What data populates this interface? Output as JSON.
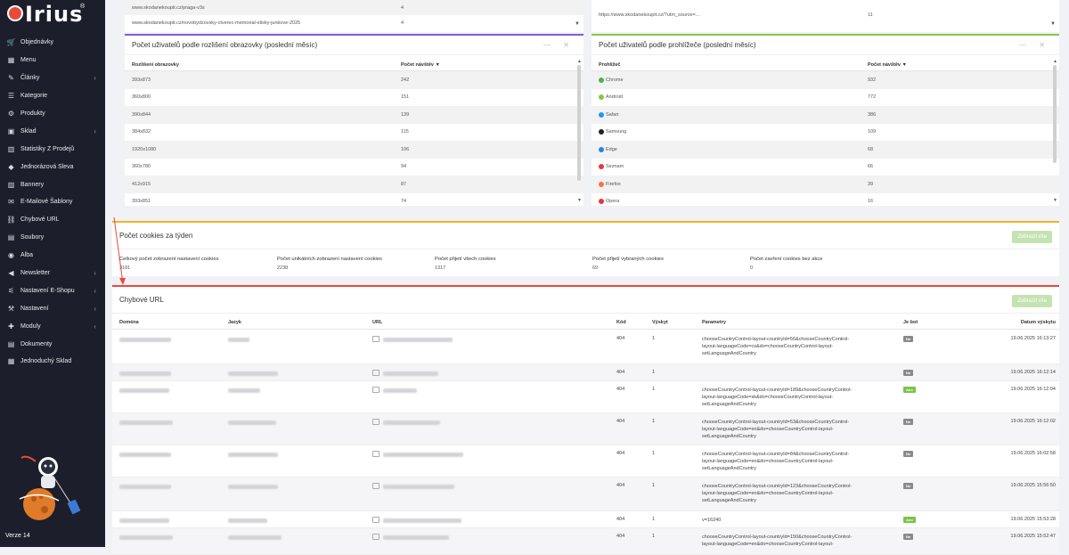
{
  "app": {
    "brand": "Irius",
    "version": "Verze 14",
    "colors": {
      "sidebar": "#1c1f2b",
      "accent_red": "#e84b3c",
      "green_btn": "#c5e3b2"
    }
  },
  "sidebar": {
    "items": [
      {
        "label": "Objednávky",
        "icon": "cart-icon",
        "chevron": false
      },
      {
        "label": "Menu",
        "icon": "menu-icon",
        "chevron": false
      },
      {
        "label": "Články",
        "icon": "pencil-icon",
        "chevron": true
      },
      {
        "label": "Kategorie",
        "icon": "list-icon",
        "chevron": false
      },
      {
        "label": "Produkty",
        "icon": "settings-icon",
        "chevron": false
      },
      {
        "label": "Sklad",
        "icon": "box-icon",
        "chevron": true
      },
      {
        "label": "Statistiky Z Prodejů",
        "icon": "chart-icon",
        "chevron": false
      },
      {
        "label": "Jednorázová Sleva",
        "icon": "tag-icon",
        "chevron": false
      },
      {
        "label": "Bannery",
        "icon": "image-icon",
        "chevron": false
      },
      {
        "label": "E-Mailové Šablony",
        "icon": "mail-icon",
        "chevron": false
      },
      {
        "label": "Chybové URL",
        "icon": "link-icon",
        "chevron": false
      },
      {
        "label": "Soubory",
        "icon": "file-icon",
        "chevron": false
      },
      {
        "label": "Alba",
        "icon": "camera-icon",
        "chevron": false
      },
      {
        "label": "Newsletter",
        "icon": "megaphone-icon",
        "chevron": true
      },
      {
        "label": "Nastavení E-Shopu",
        "icon": "sliders-icon",
        "chevron": true
      },
      {
        "label": "Nastavení",
        "icon": "wrench-icon",
        "chevron": true
      },
      {
        "label": "Moduly",
        "icon": "puzzle-icon",
        "chevron": true
      },
      {
        "label": "Dokumenty",
        "icon": "doc-icon",
        "chevron": false
      },
      {
        "label": "Jednoduchý Sklad",
        "icon": "warehouse-icon",
        "chevron": false
      }
    ]
  },
  "top_left": {
    "rows": [
      {
        "url": "www.skodanekoupit.cz/praga-v3s",
        "count": "4"
      },
      {
        "url": "www.skodanekoupit.cz/novobydzovsky-ctverec-memorial-elisky-junkove-2025",
        "count": "4"
      }
    ]
  },
  "top_right": {
    "rows": [
      {
        "url": "https://www.skodanekoupit.cz/?utm_source=...",
        "count": "11"
      }
    ]
  },
  "resolution": {
    "title": "Počet uživatelů podle rozlišení obrazovky (poslední měsíc)",
    "col1": "Rozlišení obrazovky",
    "col2": "Počet návštěv",
    "rows": [
      {
        "a": "393x873",
        "b": "242"
      },
      {
        "a": "360x800",
        "b": "151"
      },
      {
        "a": "390x844",
        "b": "139"
      },
      {
        "a": "384x832",
        "b": "115"
      },
      {
        "a": "1920x1080",
        "b": "106"
      },
      {
        "a": "360x780",
        "b": "94"
      },
      {
        "a": "412x915",
        "b": "87"
      },
      {
        "a": "393x851",
        "b": "74"
      }
    ]
  },
  "browser": {
    "title": "Počet uživatelů podle prohlížeče (poslední měsíc)",
    "col1": "Prohlížeč",
    "col2": "Počet návštěv",
    "rows": [
      {
        "a": "Chrome",
        "b": "932",
        "icon": "chrome-icon",
        "color": "#4caf50"
      },
      {
        "a": "Android",
        "b": "772",
        "icon": "android-icon",
        "color": "#8bc34a"
      },
      {
        "a": "Safari",
        "b": "386",
        "icon": "safari-icon",
        "color": "#2196f3"
      },
      {
        "a": "Samsung",
        "b": "109",
        "icon": "samsung-icon",
        "color": "#222"
      },
      {
        "a": "Edge",
        "b": "68",
        "icon": "edge-icon",
        "color": "#1e88e5"
      },
      {
        "a": "Seznam",
        "b": "66",
        "icon": "seznam-icon",
        "color": "#e53935"
      },
      {
        "a": "Firefox",
        "b": "39",
        "icon": "firefox-icon",
        "color": "#ff7043"
      },
      {
        "a": "Opera",
        "b": "16",
        "icon": "opera-icon",
        "color": "#e53935"
      }
    ]
  },
  "cookies": {
    "title": "Počet cookies za týden",
    "button": "Zobrazit vše",
    "stats": [
      {
        "label": "Celkový počet zobrazení nastavení cookies",
        "value": "3181"
      },
      {
        "label": "Počet unikátních zobrazení nastavení cookies",
        "value": "2238"
      },
      {
        "label": "Počet přijetí všech cookies",
        "value": "1317"
      },
      {
        "label": "Počet přijetí vybraných cookies",
        "value": "69"
      },
      {
        "label": "Počet zavření cookies bez akce",
        "value": "0"
      }
    ]
  },
  "errors": {
    "title": "Chybové URL",
    "button": "Zobrazit vše",
    "cols": {
      "domain": "Doména",
      "lang": "Jazyk",
      "url": "URL",
      "code": "Kód",
      "count": "Výskyt",
      "params": "Parametry",
      "bot": "Je bot",
      "date": "Datum výskytu"
    },
    "rows": [
      {
        "code": "404",
        "count": "1",
        "params": [
          "chooseCountryControl-layout-countryId=56&chooseCountryControl-",
          "layout-languageCode=cs&do=chooseCountryControl-layout-",
          "setLanguageAndCountry"
        ],
        "bot": "Ne",
        "date": "19.06.2025 16:13:27"
      },
      {
        "code": "404",
        "count": "1",
        "params": [],
        "bot": "Ne",
        "date": "19.06.2025 16:12:14"
      },
      {
        "code": "404",
        "count": "1",
        "params": [
          "chooseCountryControl-layout-countryId=189&chooseCountryControl-",
          "layout-languageCode=sk&do=chooseCountryControl-layout-",
          "setLanguageAndCountry"
        ],
        "bot": "Ano",
        "date": "19.06.2025 16:12:04"
      },
      {
        "code": "404",
        "count": "1",
        "params": [
          "chooseCountryControl-layout-countryId=53&chooseCountryControl-",
          "layout-languageCode=en&do=chooseCountryControl-layout-",
          "setLanguageAndCountry"
        ],
        "bot": "Ne",
        "date": "19.06.2025 16:12:02"
      },
      {
        "code": "404",
        "count": "1",
        "params": [
          "chooseCountryControl-layout-countryId=84&chooseCountryControl-",
          "layout-languageCode=en&do=chooseCountryControl-layout-",
          "setLanguageAndCountry"
        ],
        "bot": "Ne",
        "date": "19.06.2025 16:02:58"
      },
      {
        "code": "404",
        "count": "1",
        "params": [
          "chooseCountryControl-layout-countryId=123&chooseCountryControl-",
          "layout-languageCode=en&do=chooseCountryControl-layout-",
          "setLanguageAndCountry"
        ],
        "bot": "Ne",
        "date": "19.06.2025 15:56:50"
      },
      {
        "code": "404",
        "count": "1",
        "params": [
          "v=16240"
        ],
        "bot": "Ano",
        "date": "19.06.2025 15:53:28"
      },
      {
        "code": "404",
        "count": "1",
        "params": [
          "chooseCountryControl-layout-countryId=150&chooseCountryControl-",
          "layout-languageCode=en&do=chooseCountryControl-layout-"
        ],
        "bot": "Ne",
        "date": "19.06.2025 15:52:47"
      }
    ]
  }
}
